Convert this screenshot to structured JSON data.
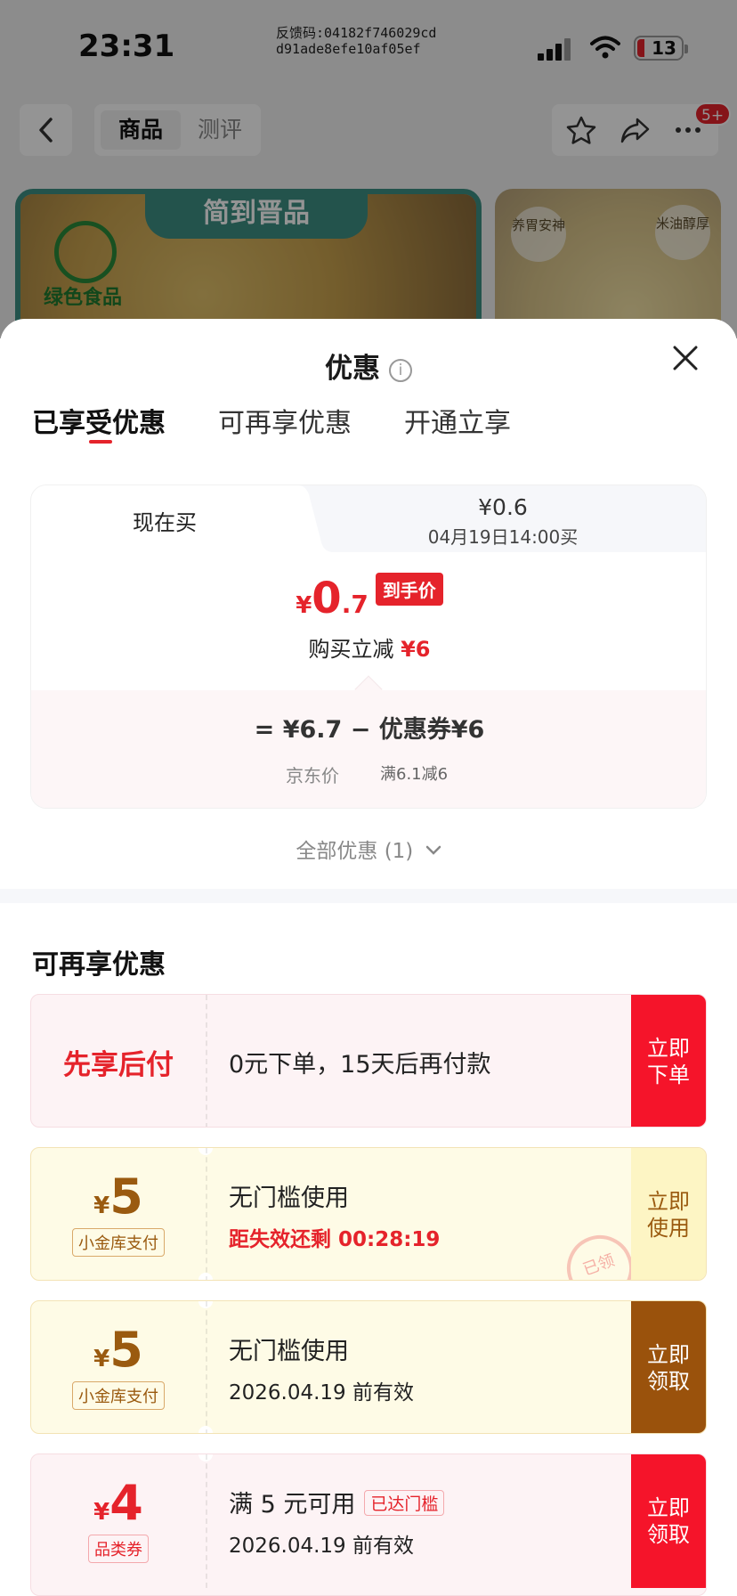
{
  "status_bar": {
    "time": "23:31",
    "feedback_line1": "反馈码:04182f746029cd",
    "feedback_line2": "d91ade8efe10af05ef",
    "battery": "13"
  },
  "nav": {
    "tab_active": "商品",
    "tab_inactive": "测评",
    "badge": "5+"
  },
  "hero": {
    "brand": "简到晋品",
    "green_label": "绿色食品",
    "right_badge1": "养胃安神",
    "right_badge2": "米油醇厚"
  },
  "sheet": {
    "title": "优惠",
    "info_icon": "i",
    "tabs": [
      "已享受优惠",
      "可再享优惠",
      "开通立享"
    ]
  },
  "price_card": {
    "now_label": "现在买",
    "future_price": "¥0.6",
    "future_time": "04月19日14:00买",
    "final_yen": "¥",
    "final_int": "0",
    "final_dec": ".7",
    "final_tag": "到手价",
    "reduce_label": "购买立减",
    "reduce_value": "¥6",
    "formula": "=  ¥6.7  −  优惠券¥6",
    "jd_price_label": "京东价",
    "coupon_rule": "满6.1减6"
  },
  "all_offers": "全部优惠 (1)",
  "section": {
    "title": "可再享优惠"
  },
  "offers": [
    {
      "left_title": "先享后付",
      "line1": "0元下单，15天后再付款",
      "button": "立即下单"
    },
    {
      "amount_yen": "¥",
      "amount": "5",
      "tag": "小金库支付",
      "line1": "无门槛使用",
      "line2": "距失效还剩 00:28:19",
      "stamp": "已领",
      "button": "立即使用"
    },
    {
      "amount_yen": "¥",
      "amount": "5",
      "tag": "小金库支付",
      "line1": "无门槛使用",
      "line2": "2026.04.19 前有效",
      "button": "立即领取"
    },
    {
      "amount_yen": "¥",
      "amount": "4",
      "tag": "品类券",
      "line1": "满 5 元可用",
      "threshold_tag": "已达门槛",
      "line2": "2026.04.19 前有效",
      "button": "立即领取"
    }
  ],
  "colors": {
    "accent": "#e5232b",
    "gold": "#9a5a0f",
    "gold_bg": "#fefbe6",
    "pink_bg": "#fdf3f5"
  }
}
